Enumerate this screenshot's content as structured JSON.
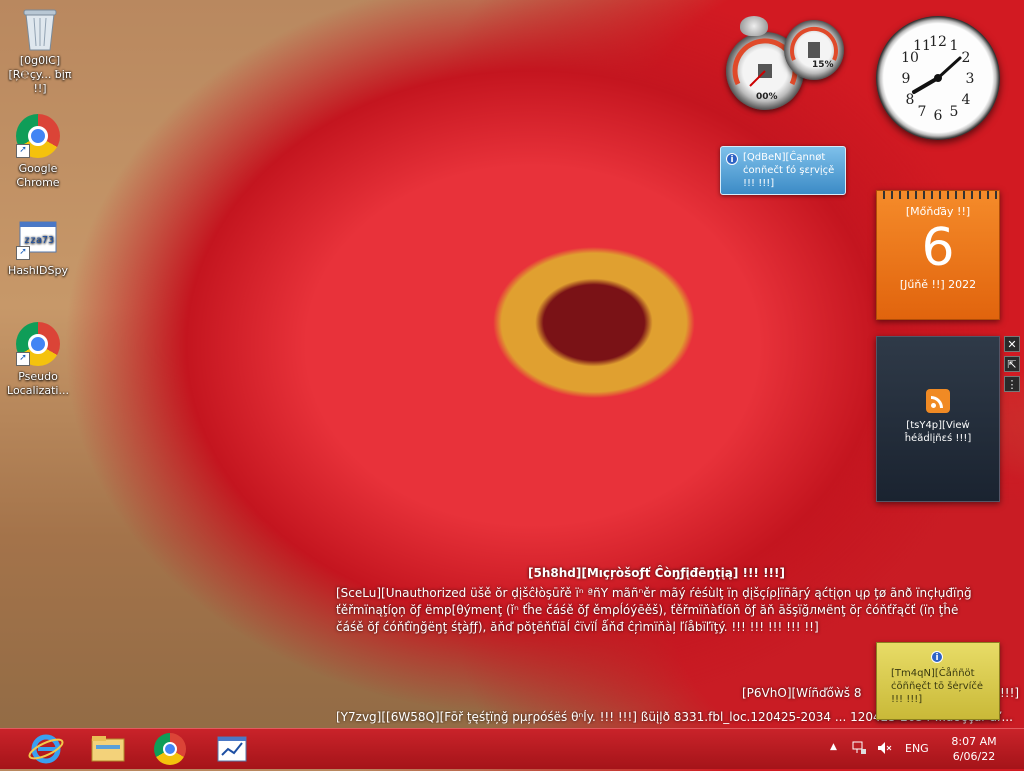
{
  "desktop": {
    "icons": [
      {
        "label": "[0g0lC][Ŗ℮çy... ƀįπ !!]",
        "icon": "recycle-bin-icon"
      },
      {
        "label": "Google Chrome",
        "icon": "chrome-icon"
      },
      {
        "label": "HashIDSpy",
        "icon": "hashidspy-icon"
      },
      {
        "label": "Pseudo Localizati...",
        "icon": "chrome-icon"
      }
    ]
  },
  "gadgets": {
    "cpu_percent": "00%",
    "memory_percent": "15%",
    "balloon_top": "[QdBeN][Ĉąnnøt ċonñеčt ťó şεŗvįçě !!! !!!]",
    "calendar_day_name": "[Mőňďāy !!]",
    "calendar_date": "6",
    "calendar_month_year": "[Jűňě !!] 2022",
    "feed_label": "[tsY4p][Vieẃ ĥéãḋlįñεś !!!]",
    "balloon_bottom": "[Tm4qN][Ċåññöt ċōññęčt tō šėŗvíčė !!! !!!]"
  },
  "watermark": {
    "title": "[5h8hd][Mıçŗòšοƒť Ĉòŋƒįđēŋţįą] !!! !!!]",
    "body": "[SceLu][Unauthorized üšě ŏr ḍįšĉłòşūřě ïⁿ ªñΥ mãñⁿěr mãý ŕėśùlţ ïņ ḍįšçíρļïñãŗý ąćtįǫn ųρ ţø ãnð ïnçŀụđïņğ ťěřmïnąţíǫņ ŏƒ ëmp[θýmеnţ (ǐⁿ ťĥe čáśě ŏƒ ěmρĺóýēěš), ťěřmïňàťíōň ŏƒ ăň āšşïğлмënţ ŏŗ ĉόňťřąčť (ïņ ţĥė čáśě ŏƒ ćóňťïŋğëŋţ śţàƒƒ), ăňď pŏţēňťïāĺ ĉïvïĺ ǻňđ ĉŗìmïňàļ ľíåbïľïţý. !!! !!! !!! !!! !!]",
    "edition": "[P6VhO][Wíñďőẁš 8",
    "edition_tail": "!!!]",
    "build": "[Y7zvg][[6W58Q][Fōř ţęśţïņğ pµŗρóśëś θⁿĺy. !!! !!!] ßüįļð 8331.fbl_loc.120425-2034 ... 120425-2034 ...ǻòççǻľ ǻľ..."
  },
  "taskbar": {
    "pinned": [
      "internet-explorer-icon",
      "file-explorer-icon",
      "chrome-icon",
      "hashidspy-icon"
    ],
    "language": "ENG",
    "time": "8:07 AM",
    "date": "6/06/22"
  },
  "colors": {
    "taskbar": "#b81b21",
    "calendar": "#e8711a",
    "balloon": "#4e9bd4"
  }
}
